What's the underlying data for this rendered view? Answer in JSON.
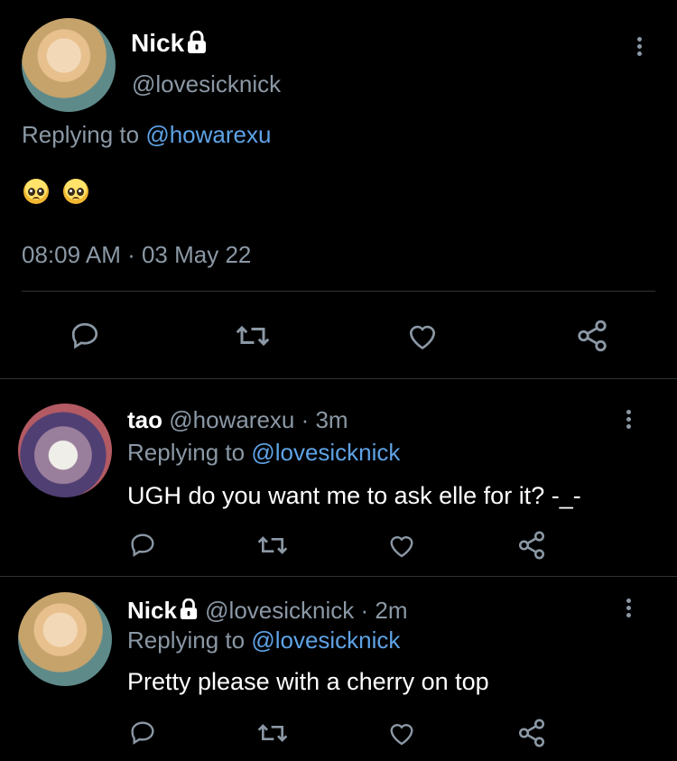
{
  "main_tweet": {
    "author_name": "Nick",
    "handle": "@lovesicknick",
    "replying_prefix": "Replying to",
    "replying_to": "@howarexu",
    "timestamp": "08:09 AM · 03 May 22"
  },
  "replies": [
    {
      "author_name": "tao",
      "meta": "@howarexu · 3m",
      "replying_prefix": "Replying to",
      "replying_to": "@lovesicknick",
      "text": "UGH do you want me to ask elle for it? -_-"
    },
    {
      "author_name": "Nick",
      "meta": "@lovesicknick · 2m",
      "replying_prefix": "Replying to",
      "replying_to": "@lovesicknick",
      "text": "Pretty please with a cherry on top"
    }
  ],
  "icons": [
    "reply-icon",
    "retweet-icon",
    "like-icon",
    "share-icon",
    "more-icon",
    "lock-icon"
  ],
  "colors": {
    "background": "#000000",
    "text": "#ffffff",
    "muted": "#8b98a5",
    "mention": "#5ea3e6",
    "divider": "#2f3336"
  }
}
